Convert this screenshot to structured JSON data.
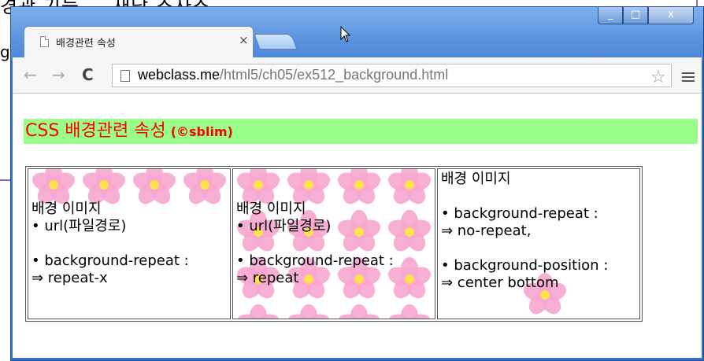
{
  "background": {
    "heading_fragment": "경관 기능 … 새당 스사스",
    "left_fragment": "g"
  },
  "window": {
    "controls": {
      "minimize": "_",
      "maximize": "□",
      "close": "x"
    }
  },
  "tab": {
    "title": "배경관련 속성",
    "close": "×"
  },
  "toolbar": {
    "back": "←",
    "forward": "→",
    "reload": "C",
    "url_host": "webclass.me",
    "url_path": "/html5/ch05/ex512_background.html",
    "star": "☆"
  },
  "page": {
    "heading": "CSS 배경관련 속성",
    "author": "(©sblim)",
    "cells": [
      {
        "line1": "배경 이미지",
        "line2": "• url(파일경로)",
        "line3": "• background-repeat :",
        "line4": "  ⇒ repeat-x"
      },
      {
        "line1": "배경 이미지",
        "line2": "• url(파일경로)",
        "line3": "• background-repeat :",
        "line4": "  ⇒ repeat"
      },
      {
        "line1": "배경 이미지",
        "line2": "• background-repeat :",
        "line3": "  ⇒ no-repeat,",
        "line4": "• background-position :",
        "line5": "  ⇒ center bottom"
      }
    ]
  },
  "colors": {
    "heading_bg": "#99ff88",
    "heading_text": "#ff0000",
    "flower_petal": "#f7a6cf",
    "flower_center": "#ffe14d"
  }
}
